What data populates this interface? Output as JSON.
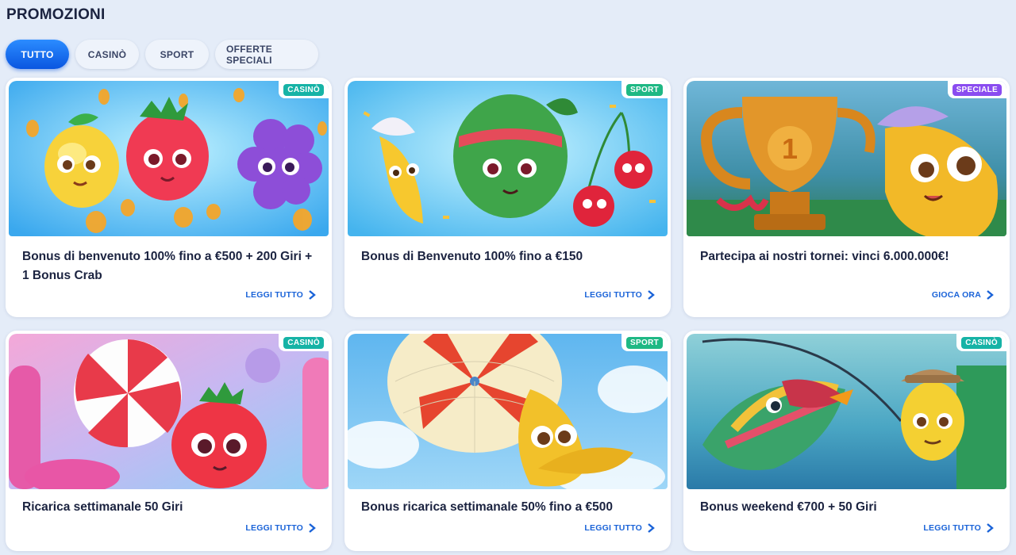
{
  "page": {
    "title": "PROMOZIONI"
  },
  "tabs": [
    {
      "label": "TUTTO",
      "active": true
    },
    {
      "label": "CASINÒ",
      "active": false
    },
    {
      "label": "SPORT",
      "active": false
    },
    {
      "label": "OFFERTE SPECIALI",
      "active": false
    }
  ],
  "cards": [
    {
      "badge": "CASINÒ",
      "badge_type": "casino",
      "title": "Bonus di benvenuto 100% fino a €500 + 200 Giri + 1 Bonus Crab",
      "link": "LEGGI TUTTO",
      "image": "fruits-coins-illustration"
    },
    {
      "badge": "SPORT",
      "badge_type": "sport",
      "title": "Bonus di Benvenuto 100% fino a €150",
      "link": "LEGGI TUTTO",
      "image": "watermelon-banana-cherries-illustration"
    },
    {
      "badge": "SPECIALE",
      "badge_type": "speciale",
      "title": "Partecipa ai nostri tornei: vinci 6.000.000€!",
      "link": "GIOCA ORA",
      "image": "trophy-banana-illustration"
    },
    {
      "badge": "CASINÒ",
      "badge_type": "casino",
      "title": "Ricarica settimanale 50 Giri",
      "link": "LEGGI TUTTO",
      "image": "candy-strawberry-illustration"
    },
    {
      "badge": "SPORT",
      "badge_type": "sport",
      "title": "Bonus ricarica settimanale 50% fino a €500",
      "link": "LEGGI TUTTO",
      "image": "parachute-banana-illustration"
    },
    {
      "badge": "CASINÒ",
      "badge_type": "casino",
      "title": "Bonus weekend €700 + 50 Giri",
      "link": "LEGGI TUTTO",
      "image": "fishing-lemon-illustration"
    }
  ],
  "colors": {
    "background": "#e4ecf8",
    "active_tab": "#0a56e0",
    "link": "#1a63d8",
    "badge_casino": "#16b3a6",
    "badge_sport": "#1eb884",
    "badge_speciale": "#8a4cf0"
  },
  "icons": {
    "link_arrow": "chevron-right-icon"
  }
}
